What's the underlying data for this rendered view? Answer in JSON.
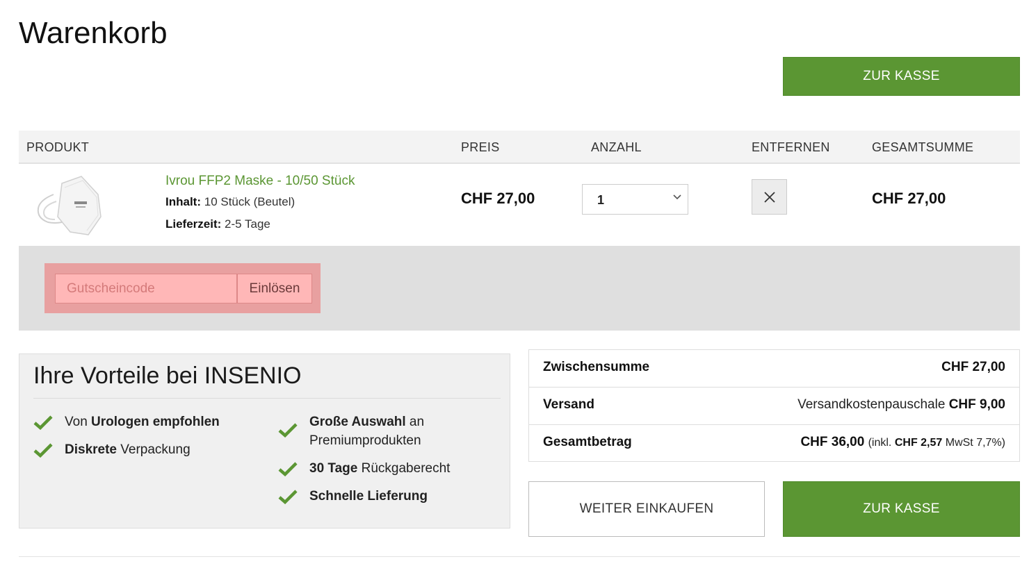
{
  "page": {
    "title": "Warenkorb"
  },
  "checkout_label": "ZUR KASSE",
  "table": {
    "headers": {
      "product": "PRODUKT",
      "price": "PREIS",
      "quantity": "ANZAHL",
      "remove": "ENTFERNEN",
      "total": "GESAMTSUMME"
    }
  },
  "item": {
    "name": "Ivrou FFP2 Maske - 10/50 Stück",
    "content_label": "Inhalt:",
    "content_value": "10 Stück (Beutel)",
    "delivery_label": "Lieferzeit:",
    "delivery_value": "2-5 Tage",
    "price": "CHF 27,00",
    "quantity": "1",
    "total": "CHF 27,00",
    "image_icon": "ffp2-mask-image",
    "remove_icon": "close-icon"
  },
  "coupon": {
    "placeholder": "Gutscheincode",
    "button": "Einlösen"
  },
  "benefits": {
    "title": "Ihre Vorteile bei INSENIO",
    "items": [
      {
        "pre": "Von ",
        "bold": "Urologen empfohlen",
        "post": ""
      },
      {
        "pre": "",
        "bold": "Diskrete",
        "post": " Verpackung"
      },
      {
        "pre": "",
        "bold": "Große Auswahl",
        "post": " an"
      },
      {
        "pre": "",
        "bold": "",
        "post": "Premiumprodukten"
      },
      {
        "pre": "",
        "bold": "30 Tage",
        "post": " Rückgaberecht"
      },
      {
        "pre": "",
        "bold": "Schnelle Lieferung",
        "post": ""
      }
    ]
  },
  "totals": {
    "subtotal_label": "Zwischensumme",
    "subtotal_value": "CHF 27,00",
    "shipping_label": "Versand",
    "shipping_text": "Versandkostenpauschale",
    "shipping_value": "CHF 9,00",
    "grand_label": "Gesamtbetrag",
    "grand_value": "CHF 36,00",
    "tax_pre": "(inkl.",
    "tax_value": "CHF 2,57",
    "tax_post": "MwSt 7,7%)"
  },
  "continue_label": "WEITER EINKAUFEN",
  "colors": {
    "accent": "#5b9633",
    "coupon_highlight": "#e8a0a0"
  }
}
